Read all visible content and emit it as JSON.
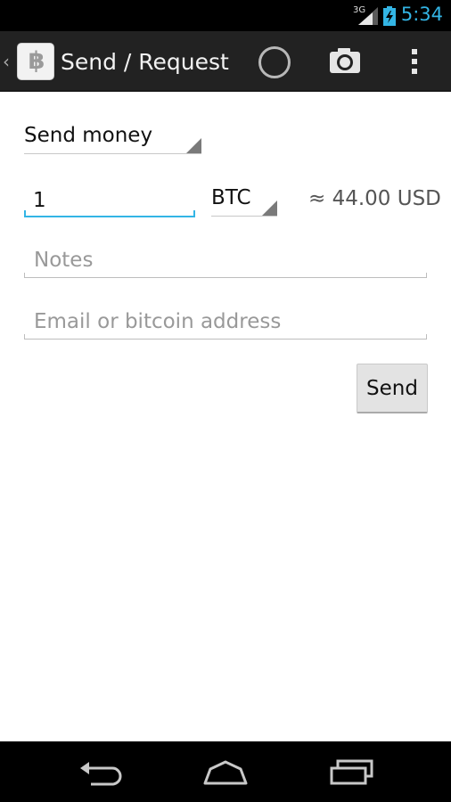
{
  "status_bar": {
    "network_type": "3G",
    "time": "5:34",
    "accent_color": "#33b5e5"
  },
  "action_bar": {
    "up_icon": "chevron-left-icon",
    "app_icon_glyph": "฿",
    "title": "Send / Request",
    "actions": [
      "progress-spinner",
      "camera-icon",
      "overflow-menu-icon"
    ]
  },
  "form": {
    "mode_selected": "Send money",
    "amount_value": "1",
    "currency_selected": "BTC",
    "converted_amount": "≈ 44.00 USD",
    "notes_placeholder": "Notes",
    "recipient_placeholder": "Email or bitcoin address",
    "send_label": "Send"
  },
  "nav_bar": {
    "buttons": [
      "back-icon",
      "home-icon",
      "recent-apps-icon"
    ]
  }
}
